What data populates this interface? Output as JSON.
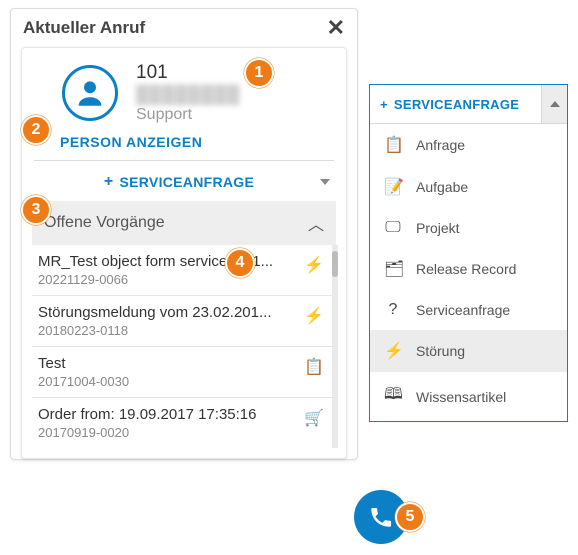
{
  "header": {
    "title": "Aktueller Anruf"
  },
  "caller": {
    "number": "101",
    "name": "████████",
    "department": "Support"
  },
  "person_link": "PERSON ANZEIGEN",
  "service_request_label": "SERVICEANFRAGE",
  "open_section": {
    "title": "Offene Vorgänge"
  },
  "tickets": [
    {
      "title": "MR_Test object form service 29.1...",
      "id": "20221129-0066",
      "icon": "bolt"
    },
    {
      "title": "Störungsmeldung vom 23.02.201...",
      "id": "20180223-0118",
      "icon": "bolt"
    },
    {
      "title": "Test",
      "id": "20171004-0030",
      "icon": "clipboard"
    },
    {
      "title": "Order from: 19.09.2017 17:35:16",
      "id": "20170919-0020",
      "icon": "cart"
    }
  ],
  "dropdown": {
    "header": "SERVICEANFRAGE",
    "items": [
      {
        "label": "Anfrage",
        "icon": "clipboard"
      },
      {
        "label": "Aufgabe",
        "icon": "task"
      },
      {
        "label": "Projekt",
        "icon": "project"
      },
      {
        "label": "Release Record",
        "icon": "release"
      },
      {
        "label": "Serviceanfrage",
        "icon": "question"
      },
      {
        "label": "Störung",
        "icon": "bolt",
        "active": true
      },
      {
        "label": "Wissensartikel",
        "icon": "knowledge"
      }
    ]
  },
  "badges": {
    "1": "1",
    "2": "2",
    "3": "3",
    "4": "4",
    "5": "5"
  }
}
